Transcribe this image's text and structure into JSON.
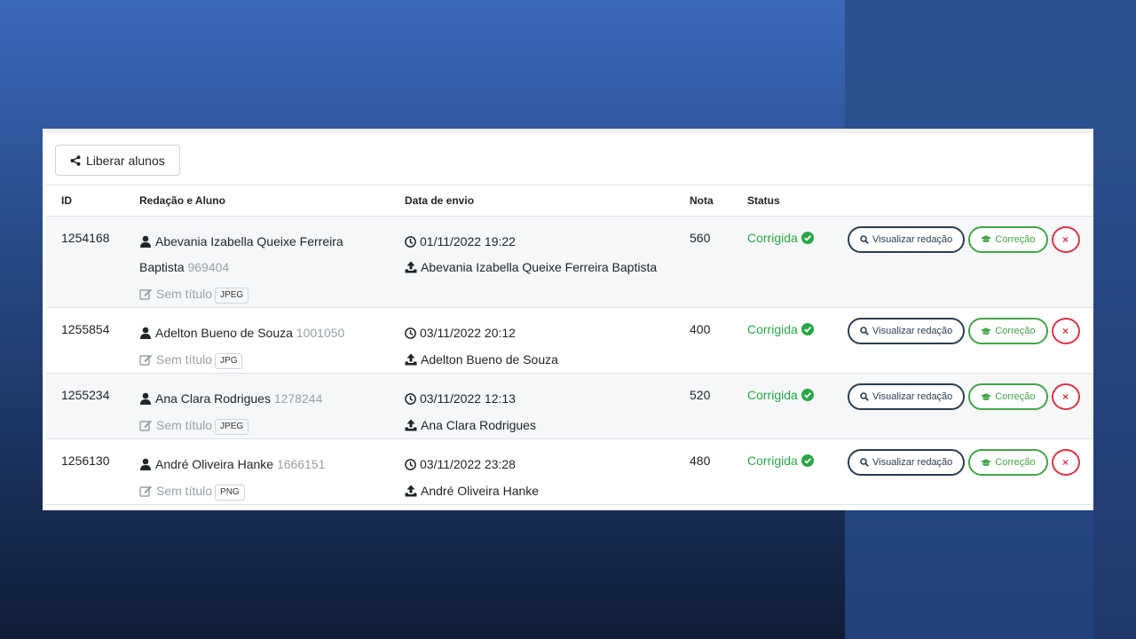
{
  "toolbar": {
    "share_label": "Liberar alunos"
  },
  "columns": {
    "id": "ID",
    "essay_student": "Redação e Aluno",
    "sent_date": "Data de envio",
    "grade": "Nota",
    "status": "Status"
  },
  "rows": [
    {
      "id": "1254168",
      "name_line1": "Abevania Izabella Queixe Ferreira",
      "name_line2": "Baptista",
      "student_code": "969404",
      "title": "Sem título",
      "file_type": "JPEG",
      "date": "01/11/2022 19:22",
      "uploader": "Abevania Izabella Queixe Ferreira Baptista",
      "grade": "560",
      "status": "Corrigida"
    },
    {
      "id": "1255854",
      "name_line1": "Adelton Bueno de Souza",
      "student_code": "1001050",
      "title": "Sem título",
      "file_type": "JPG",
      "date": "03/11/2022 20:12",
      "uploader": "Adelton Bueno de Souza",
      "grade": "400",
      "status": "Corrigida"
    },
    {
      "id": "1255234",
      "name_line1": "Ana Clara Rodrigues",
      "student_code": "1278244",
      "title": "Sem título",
      "file_type": "JPEG",
      "date": "03/11/2022 12:13",
      "uploader": "Ana Clara Rodrigues",
      "grade": "520",
      "status": "Corrigida"
    },
    {
      "id": "1256130",
      "name_line1": "André Oliveira Hanke",
      "student_code": "1666151",
      "title": "Sem título",
      "file_type": "PNG",
      "date": "03/11/2022 23:28",
      "uploader": "André Oliveira Hanke",
      "grade": "480",
      "status": "Corrigida"
    }
  ],
  "actions": {
    "view_label": "Visualizar redação",
    "correct_label": "Correção",
    "delete_label": "×"
  },
  "icons": {
    "share": "share-icon",
    "user": "user-icon",
    "edit": "edit-icon",
    "clock": "clock-icon",
    "upload": "upload-icon",
    "check": "check-circle-icon",
    "search": "search-icon",
    "graduation": "graduation-cap-icon"
  },
  "colors": {
    "success": "#28a745",
    "danger": "#dc3545",
    "dark": "#2c3e50"
  }
}
